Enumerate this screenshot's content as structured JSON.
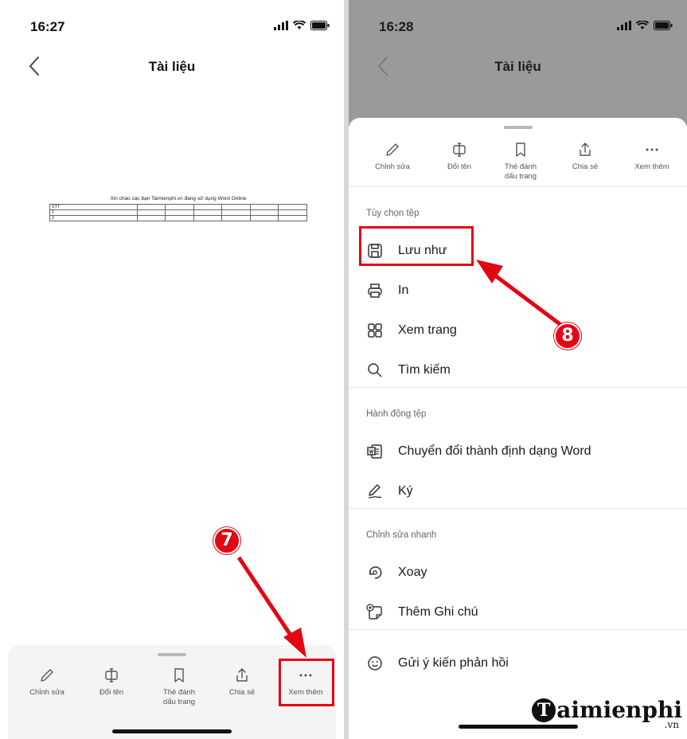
{
  "left": {
    "status_time": "16:27",
    "title": "Tài liệu",
    "document": {
      "heading": "Xin chào các bạn Taimienphi.vn đang sử dụng Word Online",
      "rows": [
        [
          "STT",
          "",
          "",
          "",
          "",
          "",
          ""
        ],
        [
          "1",
          "",
          "",
          "",
          "",
          "",
          ""
        ],
        [
          "2",
          "",
          "",
          "",
          "",
          "",
          ""
        ]
      ]
    },
    "toolbar": {
      "edit": "Chỉnh sửa",
      "rename": "Đổi tên",
      "bookmark_line1": "Thẻ đánh",
      "bookmark_line2": "dấu trang",
      "share": "Chia sẻ",
      "more": "Xem thêm"
    },
    "step_badge": "7"
  },
  "right": {
    "status_time": "16:28",
    "title": "Tài liệu",
    "toolbar": {
      "edit": "Chỉnh sửa",
      "rename": "Đổi tên",
      "bookmark_line1": "Thẻ đánh",
      "bookmark_line2": "dấu trang",
      "share": "Chia sẻ",
      "more": "Xem thêm"
    },
    "sections": {
      "file_options": "Tùy chọn tệp",
      "file_actions": "Hành động tệp",
      "quick_edit": "Chỉnh sửa nhanh"
    },
    "items": {
      "save_as": "Lưu như",
      "print": "In",
      "view_page": "Xem trang",
      "search": "Tìm kiếm",
      "convert_word": "Chuyển đổi thành định dạng Word",
      "sign": "Ký",
      "rotate": "Xoay",
      "add_note": "Thêm Ghi chú",
      "feedback": "Gửi ý kiến phản hồi"
    },
    "step_badge": "8"
  },
  "watermark": {
    "brand_initial": "T",
    "brand_rest": "aimienphi",
    "tld": ".vn"
  },
  "colors": {
    "callout_red": "#e30613",
    "overlay_gray": "#9a9a9a"
  }
}
